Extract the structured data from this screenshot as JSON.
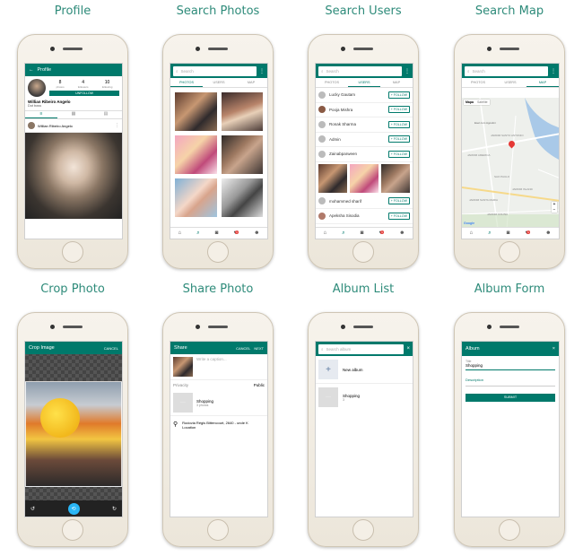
{
  "captions": [
    "Profile",
    "Search Photos",
    "Search Users",
    "Search Map",
    "Crop Photo",
    "Share Photo",
    "Album List",
    "Album Form"
  ],
  "profile": {
    "title": "Profile",
    "stats": [
      {
        "value": "8",
        "label": "photos"
      },
      {
        "value": "4",
        "label": "followers"
      },
      {
        "value": "10",
        "label": "following"
      }
    ],
    "button": "UNFOLLOW",
    "name": "Willian Ribeiro Angelo",
    "bio": "Dot boss",
    "post_author": "Willian Ribeiro Angelo"
  },
  "search_photos": {
    "placeholder": "Search",
    "tabs": [
      "PHOTOS",
      "USERS",
      "MAP"
    ]
  },
  "search_users": {
    "placeholder": "Search",
    "tabs": [
      "PHOTOS",
      "USERS",
      "MAP"
    ],
    "users": [
      "Lucky Gautam",
      "Pooja Mishra",
      "Ronak Sharma",
      "Admin",
      "Zainabparween"
    ],
    "users_bottom": [
      "mohammed sharif",
      "Apeksha Sisodia"
    ],
    "follow_label": "+ FOLLOW"
  },
  "search_map": {
    "placeholder": "Search",
    "tabs": [
      "PHOTOS",
      "USERS",
      "MAP"
    ],
    "map_toggle": [
      "Mapa",
      "Satélite"
    ],
    "labels": [
      "Esel com Agostini",
      "JARDIM SANTO ANTONIO",
      "JARDIM AMERICA",
      "SAO PAULO",
      "JARDIM SANTA MARIA",
      "JARDIM ISLAND",
      "JARDIM COLINA"
    ],
    "footer": "Google"
  },
  "crop_photo": {
    "title": "Crop Image",
    "action": "CANCEL"
  },
  "share_photo": {
    "title": "Share",
    "actions": [
      "CANCEL",
      "NEXT"
    ],
    "caption_placeholder": "Write a caption...",
    "privacity_label": "Privacity",
    "privacity_value": "Public",
    "album_name": "Shopping",
    "album_count": "3 photos",
    "location_text": "Rodovia Régis Bittencourt, 2640 - unde K",
    "location_label": "Location"
  },
  "album_list": {
    "placeholder": "Search album",
    "new_album": "New album",
    "album_name": "Shopping",
    "album_count": "3"
  },
  "album_form": {
    "title": "Album",
    "title_label": "Title",
    "title_value": "Shopping",
    "description_label": "Description",
    "submit": "SUBMIT"
  },
  "nav_badge": "1",
  "colors": {
    "primary": "#00796b",
    "caption": "#2e8b7a",
    "badge": "#e53935",
    "pin": "#e53935"
  }
}
